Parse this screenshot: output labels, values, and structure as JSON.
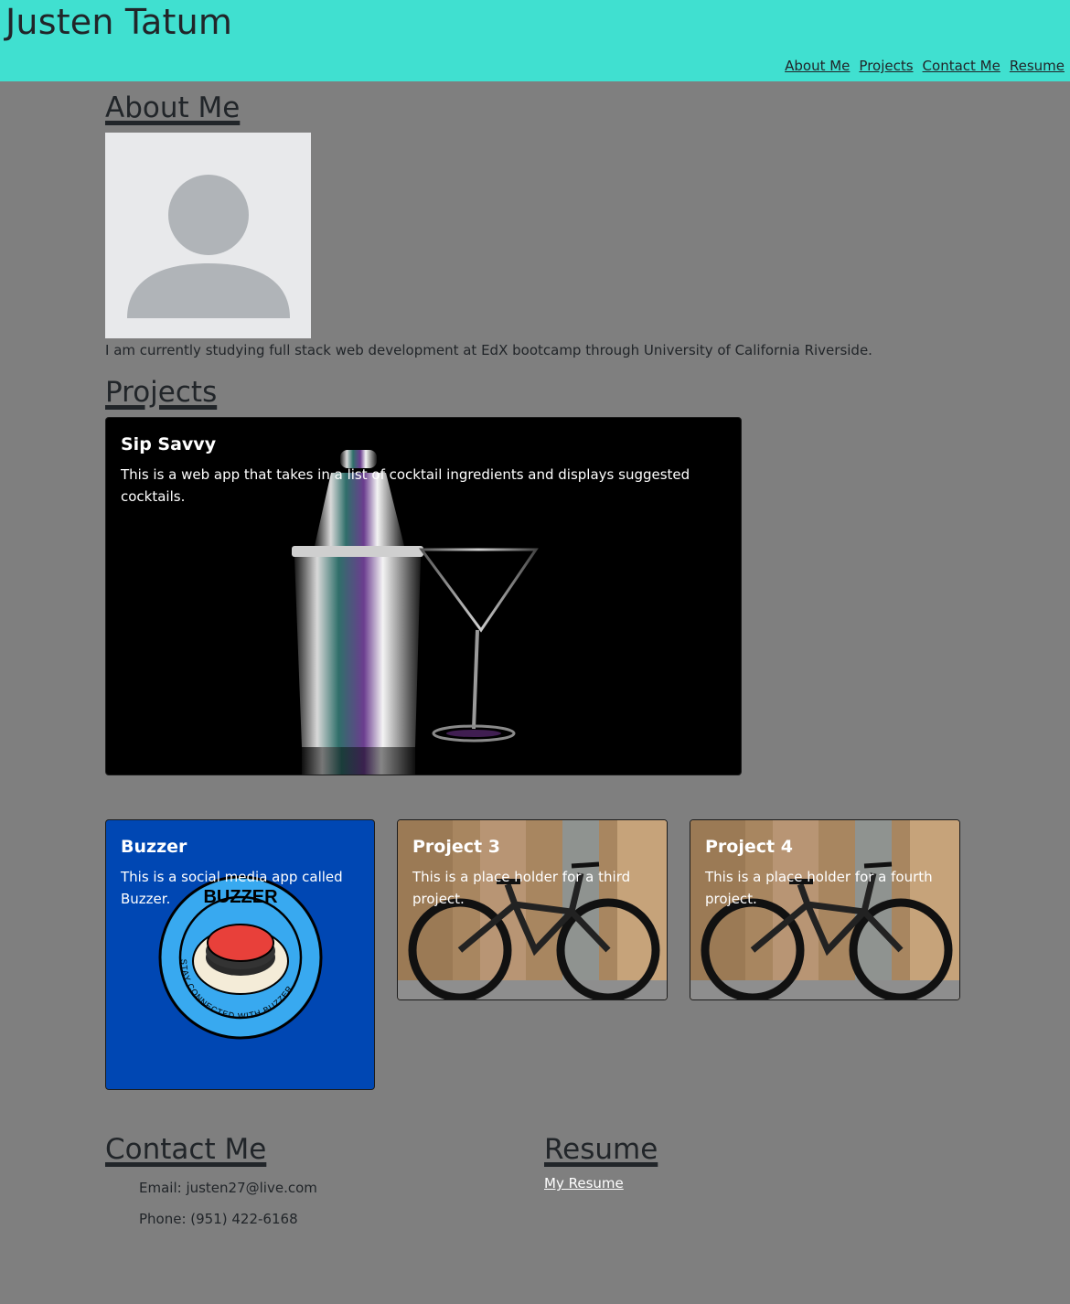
{
  "header": {
    "title": "Justen Tatum",
    "nav": [
      "About Me",
      "Projects",
      "Contact Me",
      "Resume"
    ],
    "background": "#40e0d0"
  },
  "about": {
    "heading": "About Me",
    "avatar_icon": "user-placeholder-icon",
    "bio": "I am currently studying full stack web development at EdX bootcamp through University of California Riverside."
  },
  "projects": {
    "heading": "Projects",
    "cards": [
      {
        "title": "Sip Savvy",
        "text": "This is a web app that takes in a list of cocktail ingredients and displays suggested cocktails."
      },
      {
        "title": "Buzzer",
        "text": "This is a social media app called Buzzer."
      },
      {
        "title": "Project 3",
        "text": "This is a place holder for a third project."
      },
      {
        "title": "Project 4",
        "text": "This is a place holder for a fourth project."
      }
    ],
    "buzzer_logo": {
      "top_text": "BUZZER",
      "ring_text": "STAY CONNECTED WITH BUZZER"
    }
  },
  "contact": {
    "heading": "Contact Me",
    "email": "Email: justen27@live.com",
    "phone": "Phone: (951) 422-6168"
  },
  "resume": {
    "heading": "Resume",
    "link": "My Resume"
  }
}
